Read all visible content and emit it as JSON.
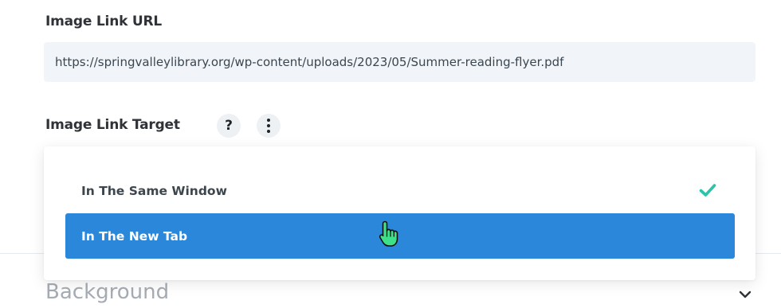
{
  "image_link_url": {
    "label": "Image Link URL",
    "value": "https://springvalleylibrary.org/wp-content/uploads/2023/05/Summer-reading-flyer.pdf"
  },
  "image_link_target": {
    "label": "Image Link Target",
    "help_icon": "question-mark-icon",
    "more_icon": "kebab-menu-icon",
    "help_text": "?",
    "options": [
      {
        "label": "In The Same Window",
        "selected": true
      },
      {
        "label": "In The New Tab",
        "selected": false,
        "hovered": true
      }
    ]
  },
  "background_section": {
    "title": "Background",
    "chevron_icon": "chevron-down-icon"
  },
  "colors": {
    "highlight": "#2b87da",
    "check": "#29c4a9",
    "field_bg": "#f1f5f9"
  }
}
